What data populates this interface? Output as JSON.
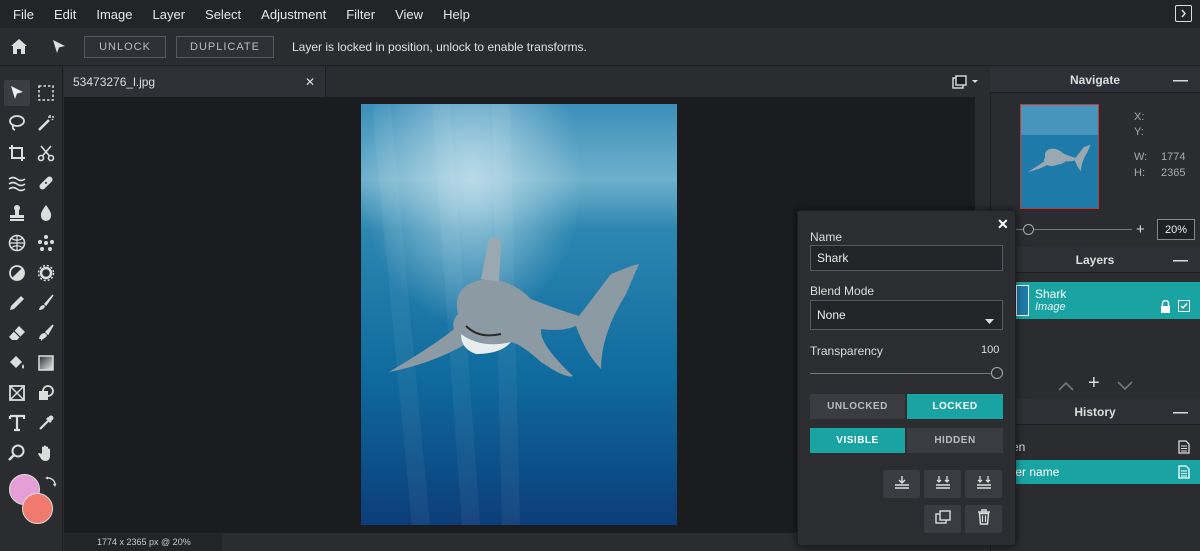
{
  "menu": [
    "File",
    "Edit",
    "Image",
    "Layer",
    "Select",
    "Adjustment",
    "Filter",
    "View",
    "Help"
  ],
  "topbar": {
    "unlock_label": "UNLOCK",
    "duplicate_label": "DUPLICATE",
    "message": "Layer is locked in position, unlock to enable transforms."
  },
  "document": {
    "tab_name": "53473276_l.jpg",
    "status": "1774 x 2365 px @ 20%"
  },
  "colors": {
    "primary": "#e4a0d6",
    "secondary": "#f07a6e",
    "accent": "#1aa3a3"
  },
  "navigate": {
    "title": "Navigate",
    "x_label": "X:",
    "y_label": "Y:",
    "w_label": "W:",
    "h_label": "H:",
    "w_value": "1774",
    "h_value": "2365",
    "zoom": "20%"
  },
  "layers": {
    "title": "Layers",
    "items": [
      {
        "name": "Shark",
        "type": "Image"
      }
    ]
  },
  "history": {
    "title": "History",
    "items": [
      "Open",
      "Layer name"
    ]
  },
  "dialog": {
    "name_label": "Name",
    "name_value": "Shark",
    "blend_label": "Blend Mode",
    "blend_value": "None",
    "transparency_label": "Transparency",
    "transparency_value": "100",
    "unlocked_label": "UNLOCKED",
    "locked_label": "LOCKED",
    "visible_label": "VISIBLE",
    "hidden_label": "HIDDEN"
  }
}
